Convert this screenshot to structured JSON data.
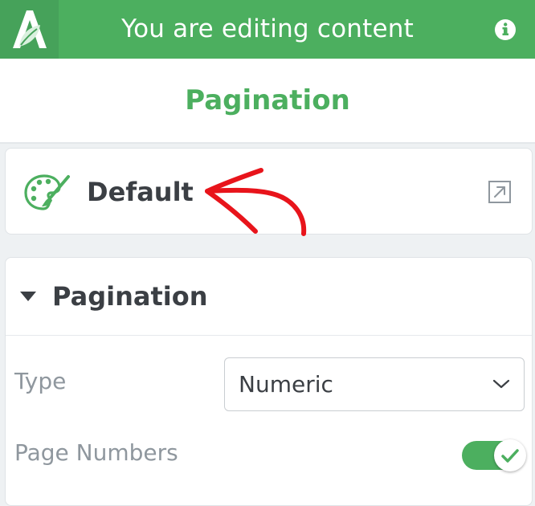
{
  "header": {
    "title": "You are editing content",
    "logo_icon": "logo-leaf-a-icon",
    "info_icon": "info-icon"
  },
  "page": {
    "title": "Pagination"
  },
  "style_card": {
    "name": "Default",
    "icon": "palette-icon",
    "open_icon": "open-external-icon"
  },
  "panel": {
    "title": "Pagination",
    "expanded": true,
    "fields": {
      "type": {
        "label": "Type",
        "value": "Numeric"
      },
      "page_numbers": {
        "label": "Page Numbers",
        "enabled": true
      }
    }
  },
  "colors": {
    "brand_green": "#4caf5f",
    "logo_green": "#46a25a",
    "annotation_red": "#e8141b",
    "text_dark": "#3b3f44",
    "text_muted": "#8f979e"
  }
}
